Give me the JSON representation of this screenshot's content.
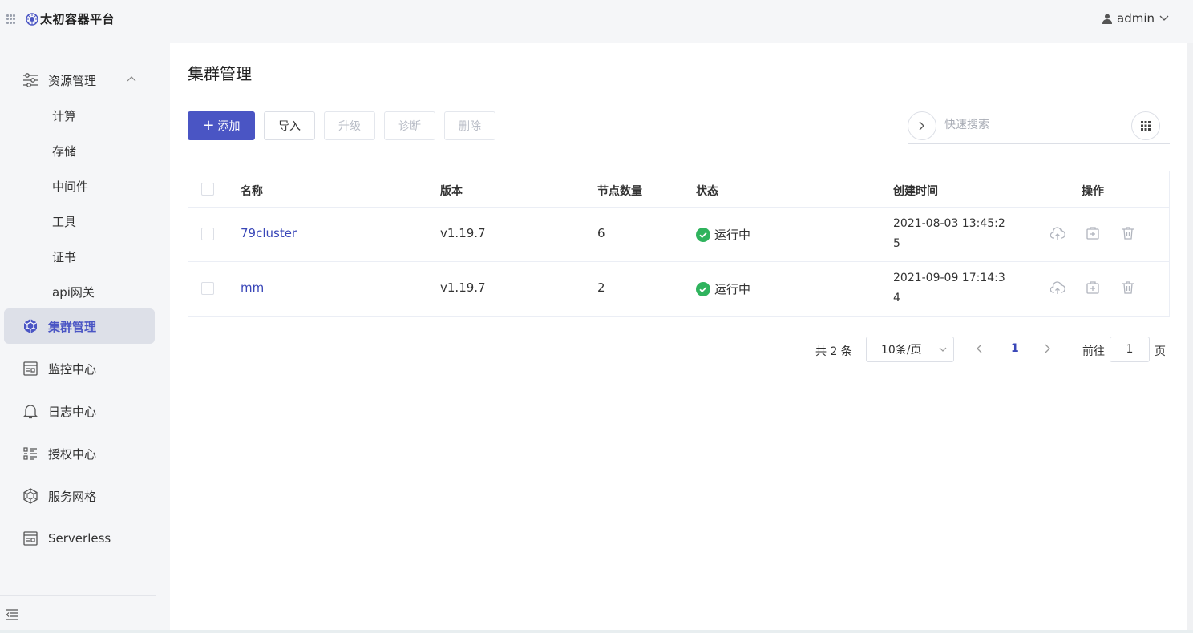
{
  "app": {
    "brand": "太初容器平台",
    "user": "admin"
  },
  "sidebar": {
    "group": {
      "label": "资源管理",
      "icon": "sliders-icon",
      "expanded": true
    },
    "subitems": [
      {
        "label": "计算"
      },
      {
        "label": "存储"
      },
      {
        "label": "中间件"
      },
      {
        "label": "工具"
      },
      {
        "label": "证书"
      },
      {
        "label": "api网关"
      }
    ],
    "items": [
      {
        "label": "集群管理",
        "icon": "cluster-icon",
        "active": true
      },
      {
        "label": "监控中心",
        "icon": "monitor-icon"
      },
      {
        "label": "日志中心",
        "icon": "bell-icon"
      },
      {
        "label": "授权中心",
        "icon": "list-icon"
      },
      {
        "label": "服务网格",
        "icon": "mesh-icon"
      },
      {
        "label": "Serverless",
        "icon": "serverless-icon"
      }
    ]
  },
  "main": {
    "title": "集群管理",
    "toolbar": {
      "add_label": "添加",
      "import_label": "导入",
      "upgrade_label": "升级",
      "diagnose_label": "诊断",
      "delete_label": "删除"
    },
    "search": {
      "placeholder": "快速搜索",
      "value": ""
    },
    "table": {
      "columns": [
        "名称",
        "版本",
        "节点数量",
        "状态",
        "创建时间",
        "操作"
      ],
      "rows": [
        {
          "name": "79cluster",
          "version": "v1.19.7",
          "nodes": "6",
          "status": "运行中",
          "time_line1": "2021-08-03 13:45:2",
          "time_line2": "5"
        },
        {
          "name": "mm",
          "version": "v1.19.7",
          "nodes": "2",
          "status": "运行中",
          "time_line1": "2021-09-09 17:14:3",
          "time_line2": "4"
        }
      ]
    },
    "pagination": {
      "total": "共 2 条",
      "page_size": "10条/页",
      "current_page": "1",
      "goto_label": "前往",
      "goto_value": "1",
      "page_suffix": "页"
    }
  },
  "colors": {
    "primary": "#4a55c4",
    "link": "#3a47b8",
    "success": "#2fb35d",
    "sidebar_active_bg": "#dde0e8"
  }
}
